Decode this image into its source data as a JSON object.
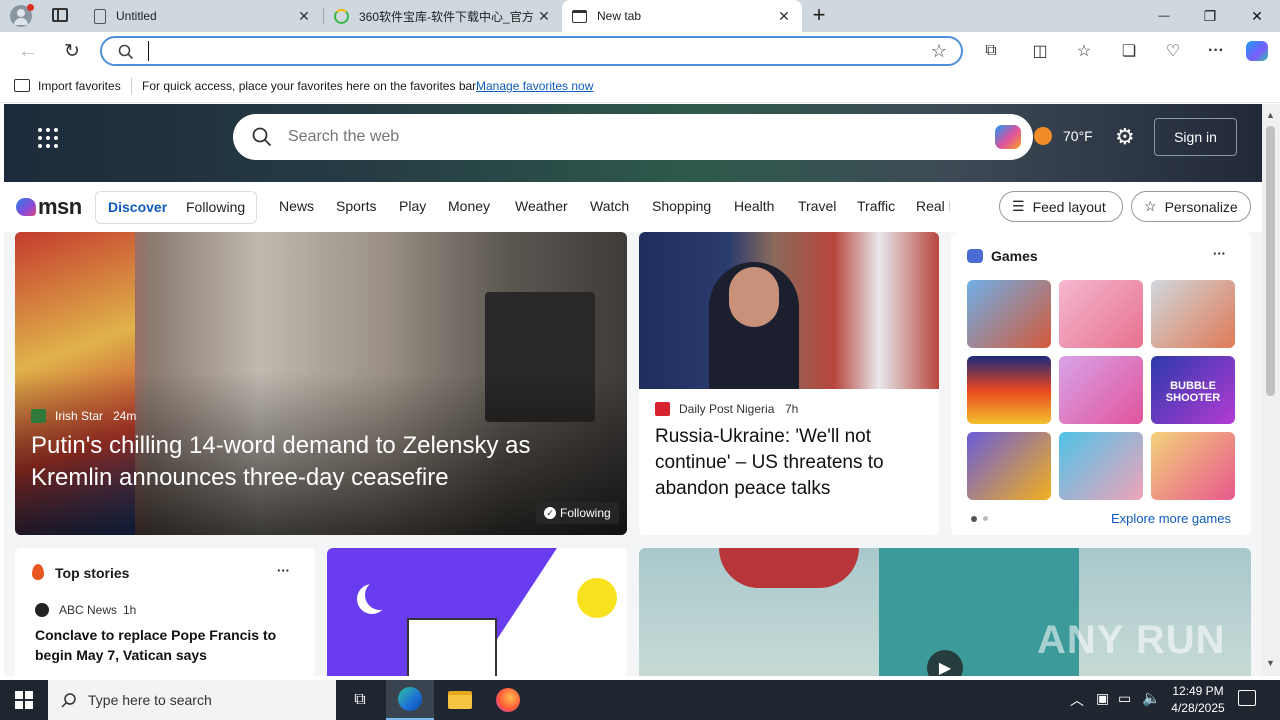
{
  "browser": {
    "tabs": [
      {
        "title": "Untitled",
        "close": "✕"
      },
      {
        "title": "360软件宝库-软件下载中心_官方",
        "close": "✕"
      },
      {
        "title": "New tab",
        "close": "✕"
      }
    ],
    "new_tab": "+",
    "window": {
      "minimize": "—",
      "restore": "❐",
      "close": "✕"
    },
    "address_value": "",
    "favorites_bar": {
      "import_label": "Import favorites",
      "message": "For quick access, place your favorites here on the favorites bar.",
      "manage_link": "Manage favorites now"
    }
  },
  "msn": {
    "search_placeholder": "Search the web",
    "weather": "70°F",
    "sign_in": "Sign in",
    "logo_text": "msn",
    "feed_tabs": [
      "Discover",
      "Following"
    ],
    "nav": [
      "News",
      "Sports",
      "Play",
      "Money",
      "Weather",
      "Watch",
      "Shopping",
      "Health",
      "Travel",
      "Traffic",
      "Real E"
    ],
    "feed_layout": "Feed layout",
    "personalize": "Personalize",
    "hero_story": {
      "source": "Irish Star",
      "age": "24m",
      "headline": "Putin's chilling 14-word demand to Zelensky as Kremlin announces three-day ceasefire",
      "following": "Following"
    },
    "story2": {
      "source": "Daily Post Nigeria",
      "age": "7h",
      "headline": "Russia-Ukraine: 'We'll not continue' – US threatens to abandon peace talks"
    },
    "games": {
      "title": "Games",
      "more": "···",
      "explore": "Explore more games",
      "tile_text": "BUBBLE SHOOTER"
    },
    "top_stories": {
      "title": "Top stories",
      "more": "···",
      "item_source": "ABC News",
      "item_age": "1h",
      "item_headline": "Conclave to replace Pope Francis to begin May 7, Vatican says"
    },
    "watermark": "ANY RUN"
  },
  "taskbar": {
    "search_placeholder": "Type here to search",
    "time": "12:49 PM",
    "date": "4/28/2025"
  }
}
